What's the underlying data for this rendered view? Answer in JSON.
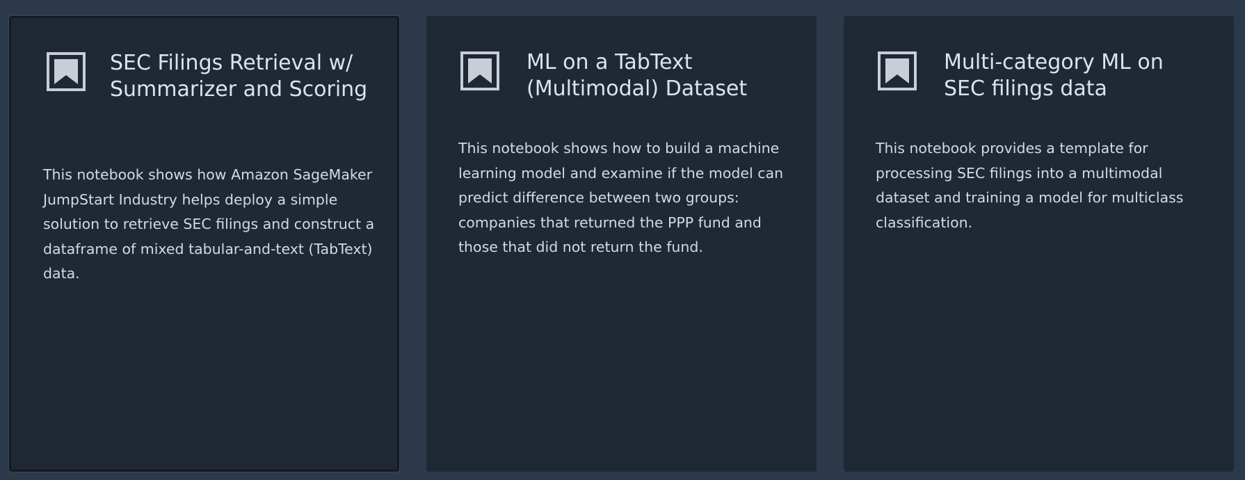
{
  "cards": [
    {
      "title": "SEC Filings Retrieval w/ Summarizer and Scoring",
      "description": "This notebook shows how Amazon SageMaker JumpStart Industry helps deploy a simple solution to retrieve SEC filings and construct a dataframe of mixed tabular-and-text (TabText) data.",
      "icon": "bookmark-icon",
      "selected": true
    },
    {
      "title": "ML on a TabText (Multimodal) Dataset",
      "description": "This notebook shows how to build a machine learning model and examine if the model can predict difference between two groups: companies that returned the PPP fund and those that did not return the fund.",
      "icon": "bookmark-icon",
      "selected": false
    },
    {
      "title": "Multi-category ML on SEC filings data",
      "description": "This notebook provides a template for processing SEC filings into a multimodal dataset and training a model for multiclass classification.",
      "icon": "bookmark-icon",
      "selected": false
    }
  ],
  "colors": {
    "page_background": "#2c394b",
    "card_background": "#1f2835",
    "text": "#dde3ea",
    "icon": "#c9ced6"
  }
}
